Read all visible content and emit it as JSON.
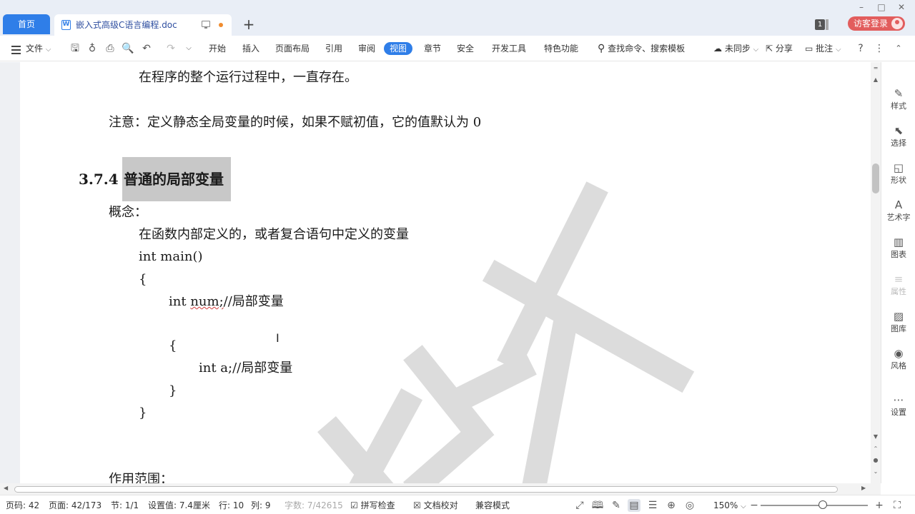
{
  "tabs": {
    "home_label": "首页",
    "doc_title": "嵌入式高级C语言编程.doc",
    "new_tab_symbol": "+"
  },
  "top_right": {
    "badge": "1",
    "login_label": "访客登录"
  },
  "ribbon": {
    "file_label": "文件",
    "menus": [
      "开始",
      "插入",
      "页面布局",
      "引用",
      "审阅",
      "视图",
      "章节",
      "安全",
      "开发工具",
      "特色功能"
    ],
    "active_menu": "视图",
    "search_placeholder": "查找命令、搜索模板",
    "sync_label": "未同步",
    "share_label": "分享",
    "comment_label": "批注"
  },
  "document": {
    "line1": "在程序的整个运行过程中，一直存在。",
    "note": "注意：定义静态全局变量的时候，如果不赋初值，它的值默认为 0",
    "section_number": "3.7.4",
    "section_title": "普通的局部变量",
    "concept_label": "概念：",
    "concept_text": "在函数内部定义的，或者复合语句中定义的变量",
    "code": {
      "line1": "int main()",
      "line2": "{",
      "line3_kw": "int ",
      "line3_var": "num;",
      "line3_comment": "//局部变量",
      "line4": "{",
      "line5": "int a;//局部变量",
      "line6": "}",
      "line7": "}"
    },
    "scope_label": "作用范围："
  },
  "side_panel": {
    "items": [
      "样式",
      "选择",
      "形状",
      "艺术字",
      "图表",
      "属性",
      "图库",
      "风格",
      "设置"
    ],
    "disabled": [
      "属性"
    ]
  },
  "status": {
    "page_code": "页码: 42",
    "page": "页面: 42/173",
    "section": "节: 1/1",
    "setting": "设置值: 7.4厘米",
    "row": "行: 10",
    "col": "列: 9",
    "word_count": "字数: 7/42615",
    "spell_check": "拼写检查",
    "doc_proof": "文档校对",
    "compat_mode": "兼容模式",
    "zoom": "150%",
    "zoom_level": 1.5
  },
  "colors": {
    "accent": "#2f7ee8",
    "login": "#e25d5d",
    "highlight": "#c8c8c8",
    "watermark": "#d9d9d9"
  }
}
